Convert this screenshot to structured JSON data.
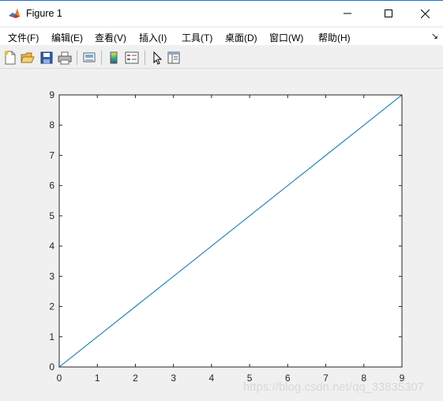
{
  "window": {
    "title": "Figure 1",
    "accent_color": "#1f6fd0"
  },
  "icons": {
    "app": "matlab-logo-icon",
    "minimize": "minimize-icon",
    "maximize": "maximize-icon",
    "close": "close-icon",
    "menu_more": "menu-overflow-arrow-icon"
  },
  "menubar": {
    "items": [
      "文件(F)",
      "编辑(E)",
      "查看(V)",
      "插入(I)",
      "工具(T)",
      "桌面(D)",
      "窗口(W)",
      "帮助(H)"
    ],
    "overflow_glyph": "↘"
  },
  "toolbar": {
    "buttons": [
      "new-figure-icon",
      "open-file-icon",
      "save-icon",
      "print-icon",
      "link-plot-icon",
      "colorbar-icon",
      "legend-icon",
      "edit-plot-pointer-icon",
      "property-inspector-icon"
    ]
  },
  "chart_data": {
    "type": "line",
    "title": "",
    "xlabel": "",
    "ylabel": "",
    "xlim": [
      0,
      9
    ],
    "ylim": [
      0,
      9
    ],
    "x_ticks": [
      "0",
      "1",
      "2",
      "3",
      "4",
      "5",
      "6",
      "7",
      "8",
      "9"
    ],
    "y_ticks": [
      "0",
      "1",
      "2",
      "3",
      "4",
      "5",
      "6",
      "7",
      "8",
      "9"
    ],
    "grid": false,
    "line_color": "#0072bd",
    "series": [
      {
        "x": [
          0,
          1,
          2,
          3,
          4,
          5,
          6,
          7,
          8,
          9
        ],
        "values": [
          0,
          1,
          2,
          3,
          4,
          5,
          6,
          7,
          8,
          9
        ]
      }
    ]
  },
  "watermark": {
    "text": "https://blog.csdn.net/qq_33835307"
  }
}
